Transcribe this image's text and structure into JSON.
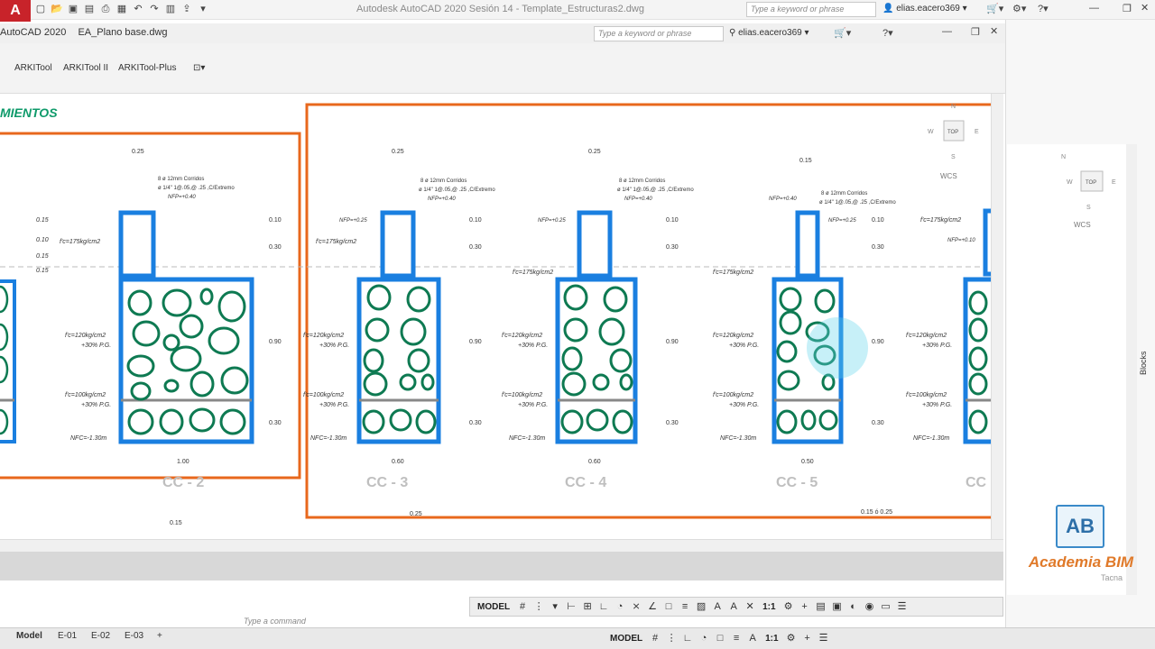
{
  "outer": {
    "app_letter": "A",
    "title": "Autodesk AutoCAD 2020    Sesión 14 - Template_Estructuras2.dwg",
    "search_placeholder": "Type a keyword or phrase",
    "user": "elias.eacero369"
  },
  "inner": {
    "app_label": "AutoCAD 2020",
    "file_name": "EA_Plano base.dwg",
    "search_placeholder": "Type a keyword or phrase",
    "user": "elias.eacero369"
  },
  "ribbon_tabs": [
    "ARKITool",
    "ARKITool II",
    "ARKITool-Plus"
  ],
  "drawing": {
    "heading": "MIENTOS",
    "sections": [
      "CC - 2",
      "CC - 3",
      "CC - 4",
      "CC - 5",
      "CC"
    ],
    "widths": [
      "1.00",
      "0.60",
      "0.60",
      "0.50"
    ],
    "top_dims": [
      "0.25",
      "0.25",
      "0.25",
      "0.15"
    ],
    "bottom_dims": [
      "0.15",
      "0.25",
      "0.15 ó 0.25"
    ],
    "rebar_note_1": "8 ø 12mm Corridos",
    "rebar_note_2": "ø 1/4\" 1@.05,@ .25 ,C/Extremo",
    "nfp_1": "NFP=+0.40",
    "nfp_2": "NFP=+0.25",
    "nfp_3": "NFP=+0.10",
    "fc_175": "f'c=175kg/cm2",
    "fc_120": "f'c=120kg/cm2",
    "fc_100": "f'c=100kg/cm2",
    "pg": "+30% P.G.",
    "nfc": "NFC=-1.30m",
    "levels": [
      "0.10",
      "0.30",
      "0.90",
      "0.30"
    ],
    "left_levels": [
      "0.15",
      "0.10",
      "0.15",
      "0.15"
    ],
    "viewcube_top": "TOP",
    "viewcube_n": "N",
    "viewcube_w": "W",
    "viewcube_e": "E",
    "viewcube_s": "S",
    "wcs": "WCS"
  },
  "status": {
    "model": "MODEL",
    "scale": "1:1",
    "command_prompt": "Type a command"
  },
  "layout_tabs": [
    "Model",
    "E-01",
    "E-02",
    "E-03"
  ],
  "right_panel": {
    "viewcube_top": "TOP",
    "wcs": "WCS",
    "blocks_label": "Blocks",
    "academia_logo": "AB",
    "academia_name": "Academia BIM",
    "academia_city": "Tacna"
  },
  "colors": {
    "concrete_outline": "#1a7fe0",
    "stones": "#0e7a52",
    "frame": "#e8681d",
    "heading": "#0e9a6a"
  }
}
